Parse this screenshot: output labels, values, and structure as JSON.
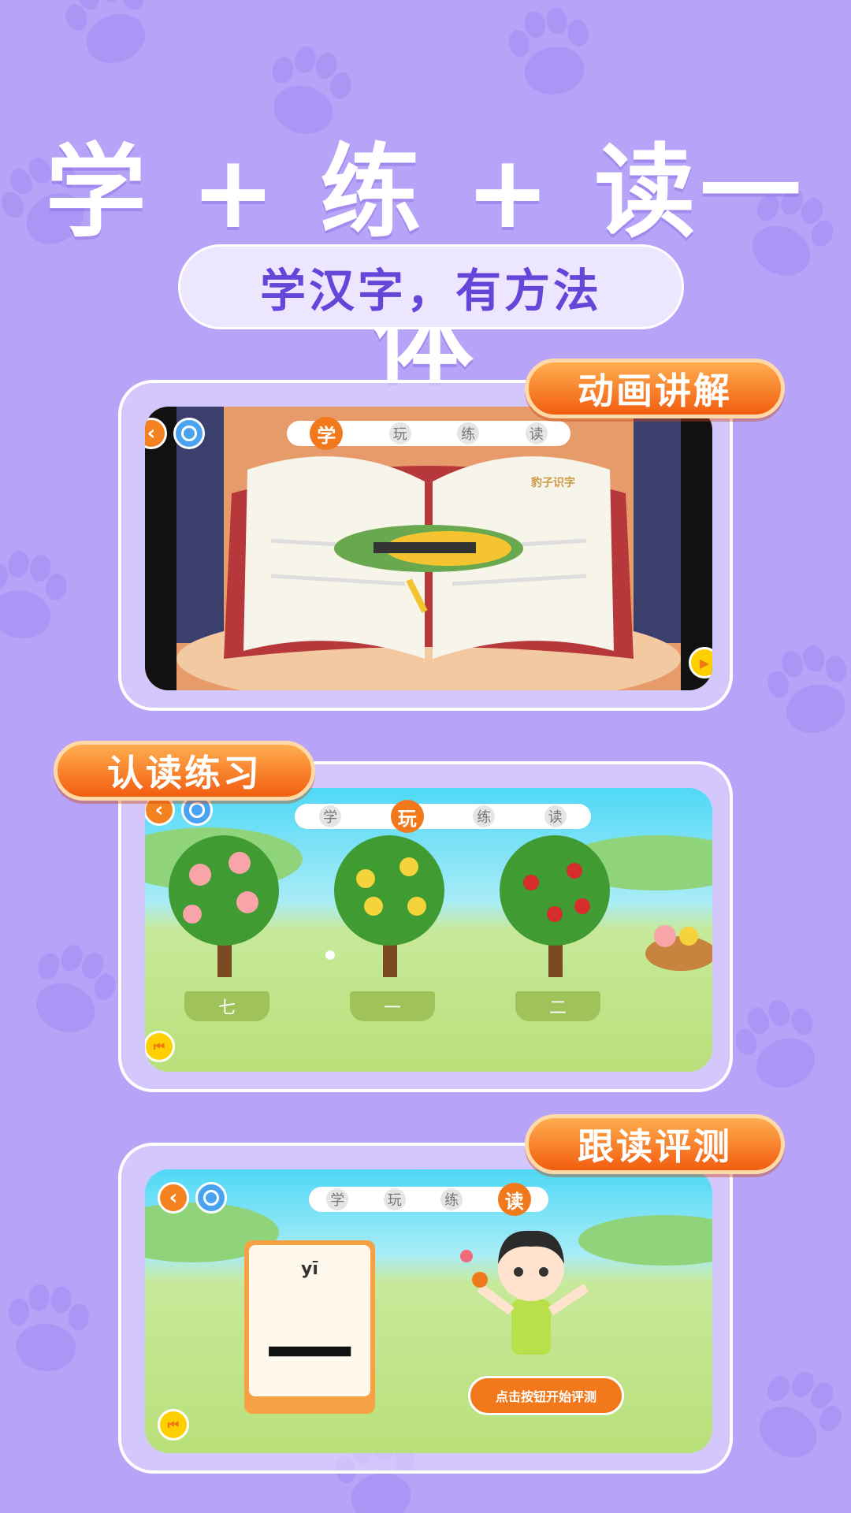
{
  "headline": "学 + 练 + 读一体",
  "subtitle": "学汉字，有方法",
  "colors": {
    "background": "#b7a3f8",
    "accent": "#f2781c",
    "title": "#6645d9"
  },
  "tabs": [
    "学",
    "玩",
    "练",
    "读"
  ],
  "cards": [
    {
      "badge": "动画讲解",
      "active_tab": "学",
      "scene": "book-corn",
      "logo_text": "豹子识字"
    },
    {
      "badge": "认读练习",
      "active_tab": "玩",
      "scene": "fruit-trees",
      "tree_labels": [
        "七",
        "一",
        "二"
      ]
    },
    {
      "badge": "跟读评测",
      "active_tab": "读",
      "scene": "read-along",
      "pinyin": "yī",
      "character": "一",
      "start_button": "点击按钮开始评测"
    }
  ],
  "icons": [
    "back-icon",
    "camera-icon",
    "replay-icon",
    "play-icon",
    "paw-icon"
  ]
}
